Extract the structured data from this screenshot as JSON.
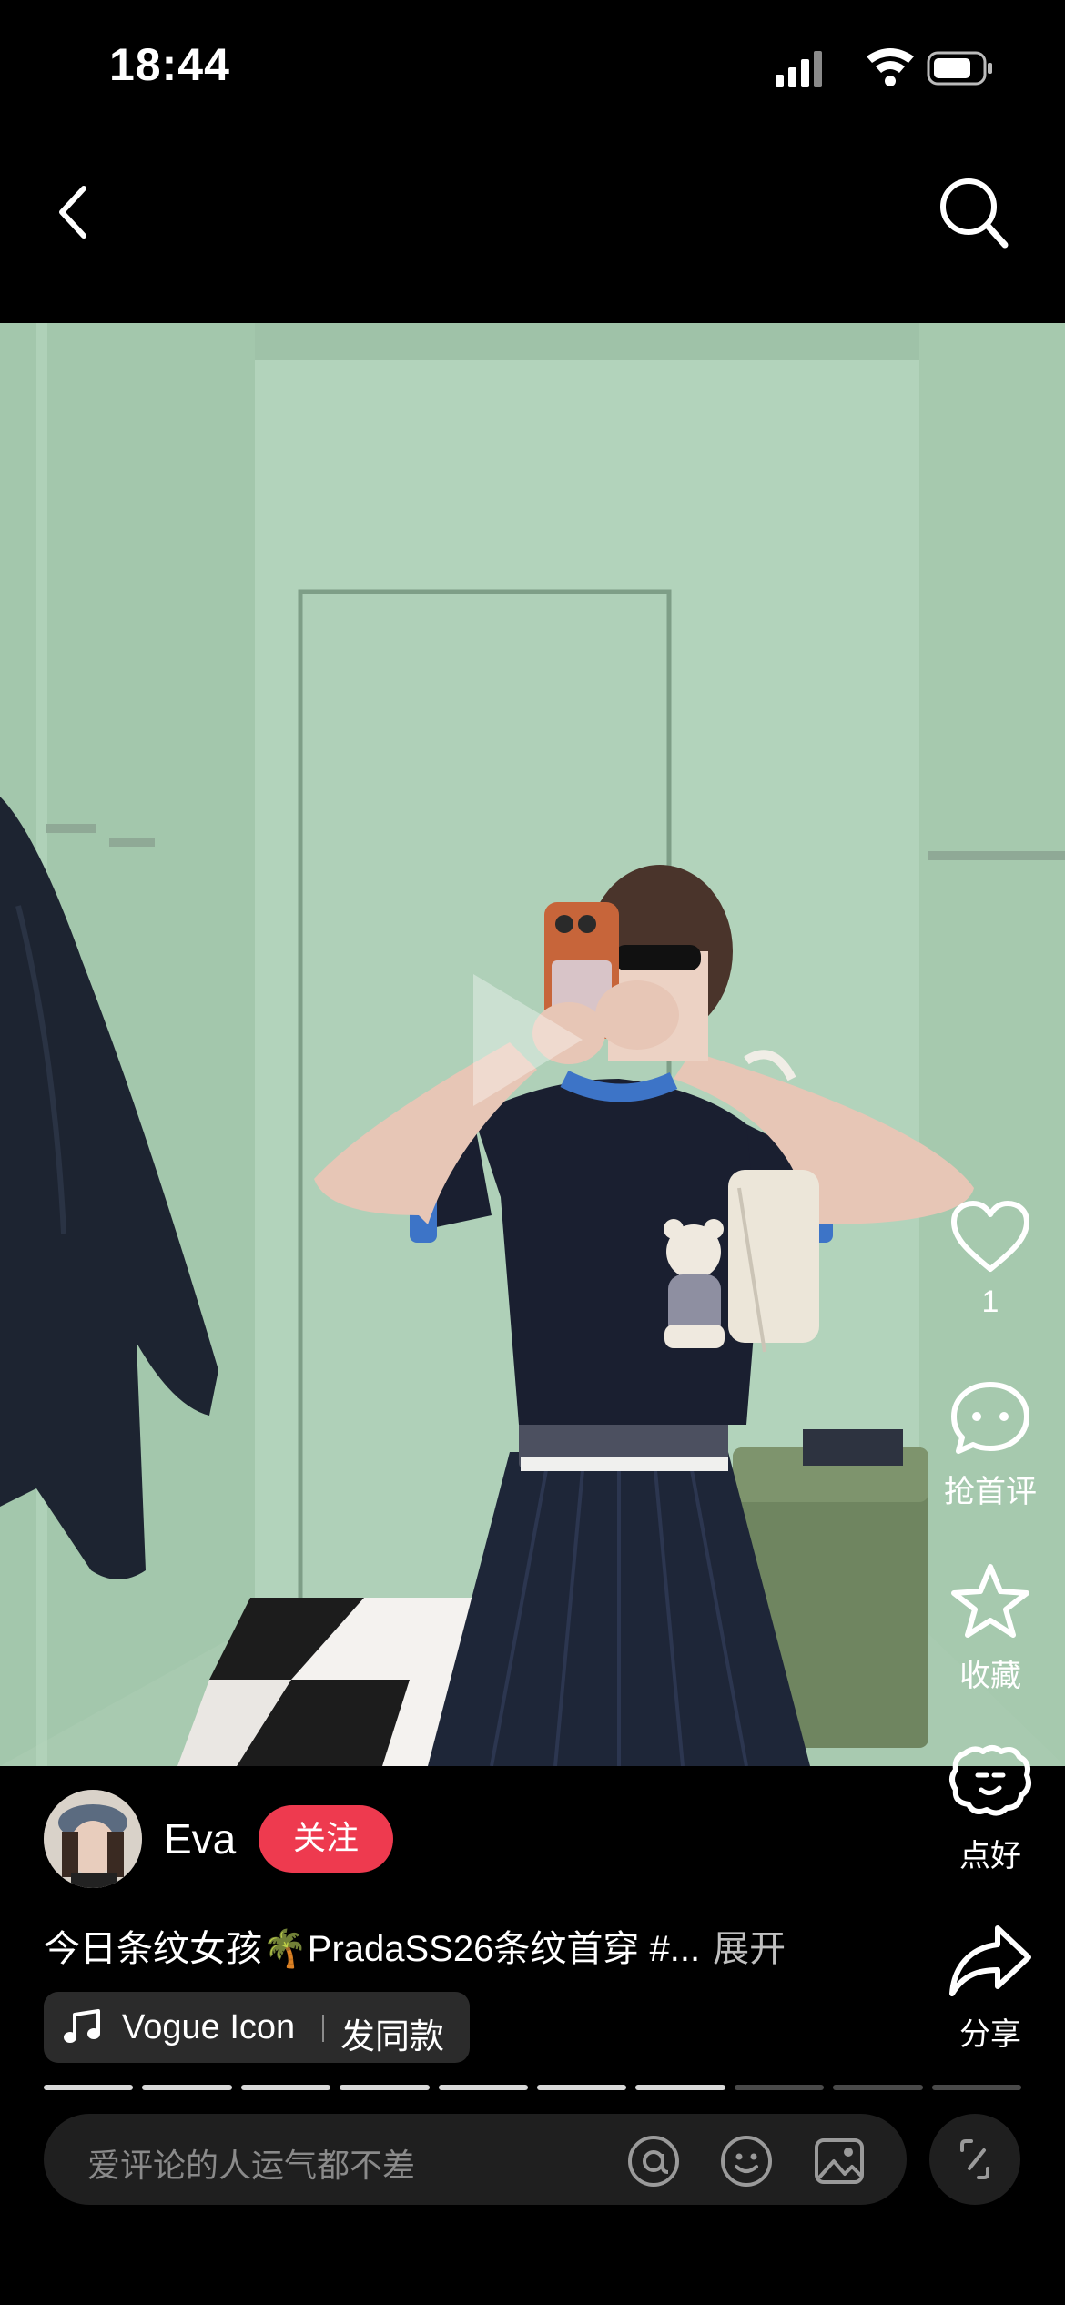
{
  "status_bar": {
    "time": "18:44"
  },
  "post": {
    "author": "Eva",
    "follow_label": "关注",
    "caption": "今日条纹女孩🌴PradaSS26条纹首穿 #...",
    "expand_label": "展开"
  },
  "actions": {
    "like_count": "1",
    "comment_label": "抢首评",
    "collect_label": "收藏",
    "nice_label": "点好",
    "share_label": "分享"
  },
  "music": {
    "title": "Vogue Icon",
    "use_sound_label": "发同款"
  },
  "progress": {
    "total_segments": 10,
    "viewed_segments": 7
  },
  "comment_input": {
    "placeholder": "爱评论的人运气都不差"
  },
  "colors": {
    "accent": "#ee3a4f",
    "background": "#000000"
  }
}
